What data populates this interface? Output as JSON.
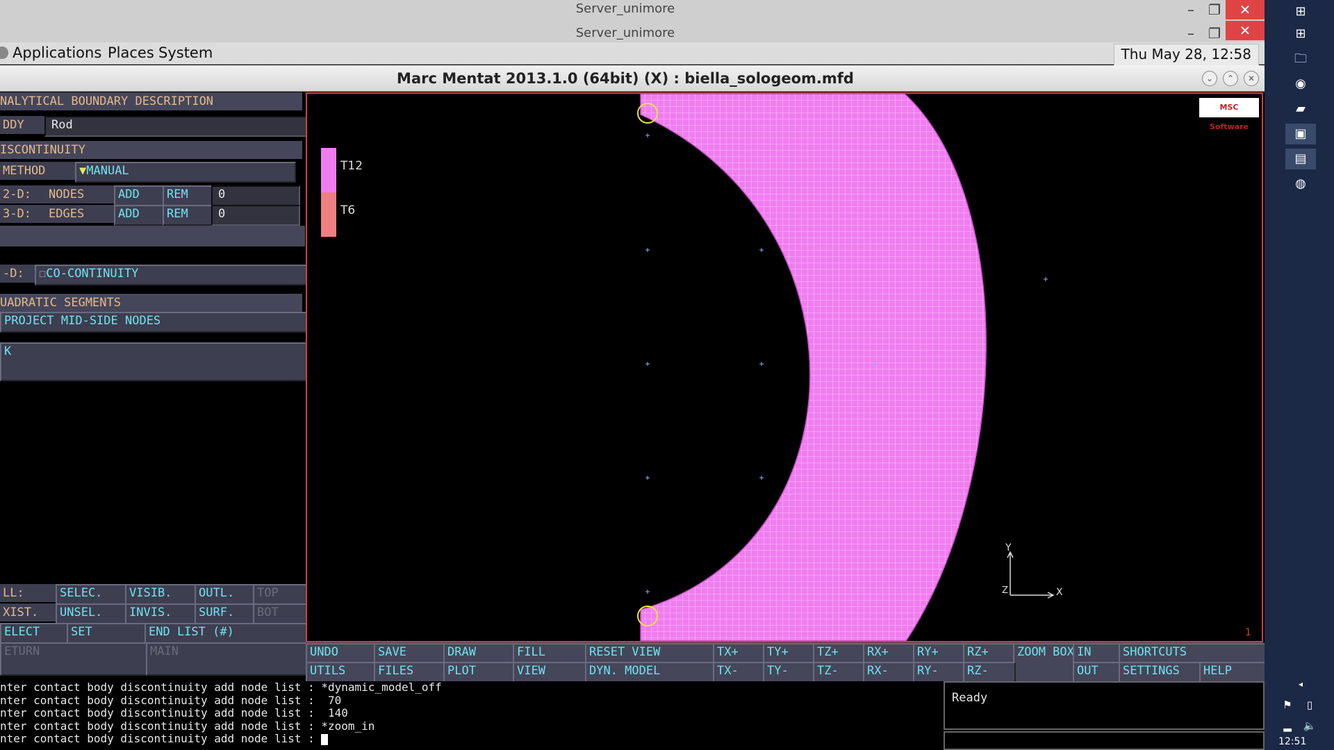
{
  "remote": {
    "title_top": "Server_unimore",
    "title_bottom": "Server_unimore"
  },
  "gnome": {
    "applications": "Applications",
    "places": "Places",
    "system": "System",
    "clock": "Thu May 28, 12:58"
  },
  "app": {
    "title": "Marc Mentat 2013.1.0 (64bit) (X) : biella_sologeom.mfd"
  },
  "panel": {
    "header": "NALYTICAL BOUNDARY DESCRIPTION",
    "body_label": "DDY",
    "body_value": "Rod",
    "discontinuity": "ISCONTINUITY",
    "method_label": "METHOD",
    "method_value": "MANUAL",
    "row2d_label": "2-D:",
    "row2d_type": "NODES",
    "row2d_add": "ADD",
    "row2d_rem": "REM",
    "row2d_count": "0",
    "row3d_label": "3-D:",
    "row3d_type": "EDGES",
    "row3d_add": "ADD",
    "row3d_rem": "REM",
    "row3d_count": "0",
    "cod_label": "-D:",
    "cod_value": "CO-CONTINUITY",
    "quad_header": "UADRATIC SEGMENTS",
    "project_mid": "PROJECT MID-SIDE NODES",
    "ok_label": "K",
    "sel_all": "LL:",
    "sel_exist": "XIST.",
    "select_label": "ELECT",
    "return_label": "ETURN",
    "b_selec": "SELEC.",
    "b_visib": "VISIB.",
    "b_outl": "OUTL.",
    "b_top": "TOP",
    "b_unsel": "UNSEL.",
    "b_invis": "INVIS.",
    "b_surf": "SURF.",
    "b_bot": "BOT",
    "b_set": "SET",
    "b_endlist": "END LIST (#)",
    "b_main": "MAIN"
  },
  "viewport": {
    "legend": [
      {
        "label": "T12",
        "color": "#f07df0"
      },
      {
        "label": "T6",
        "color": "#f08080"
      }
    ],
    "axis_y": "Y",
    "axis_x": "X",
    "axis_z": "Z",
    "corner_num": "1",
    "msc_logo": "MSC Software"
  },
  "toolbar": {
    "row1": [
      "UNDO",
      "SAVE",
      "DRAW",
      "FILL",
      "RESET VIEW",
      "TX+",
      "TY+",
      "TZ+",
      "RX+",
      "RY+",
      "RZ+",
      "ZOOM BOX",
      "IN",
      "SHORTCUTS"
    ],
    "row2": [
      "UTILS",
      "FILES",
      "PLOT",
      "VIEW",
      "DYN. MODEL",
      "TX-",
      "TY-",
      "TZ-",
      "RX-",
      "RY-",
      "RZ-",
      "OUT",
      "SETTINGS",
      "HELP"
    ]
  },
  "console": {
    "lines": [
      "nter contact body discontinuity add node list : *dynamic_model_off",
      "nter contact body discontinuity add node list :  70",
      "nter contact body discontinuity add node list :  140",
      "nter contact body discontinuity add node list : *zoom_in",
      "nter contact body discontinuity add node list : "
    ]
  },
  "status": {
    "text": "Ready"
  },
  "taskbar": {
    "time": "12:51"
  },
  "colors": {
    "mesh_fill": "#f07df0",
    "panel_bg": "#3d3e50",
    "button_text": "#6fe3ee",
    "label_text": "#e4b98c"
  }
}
